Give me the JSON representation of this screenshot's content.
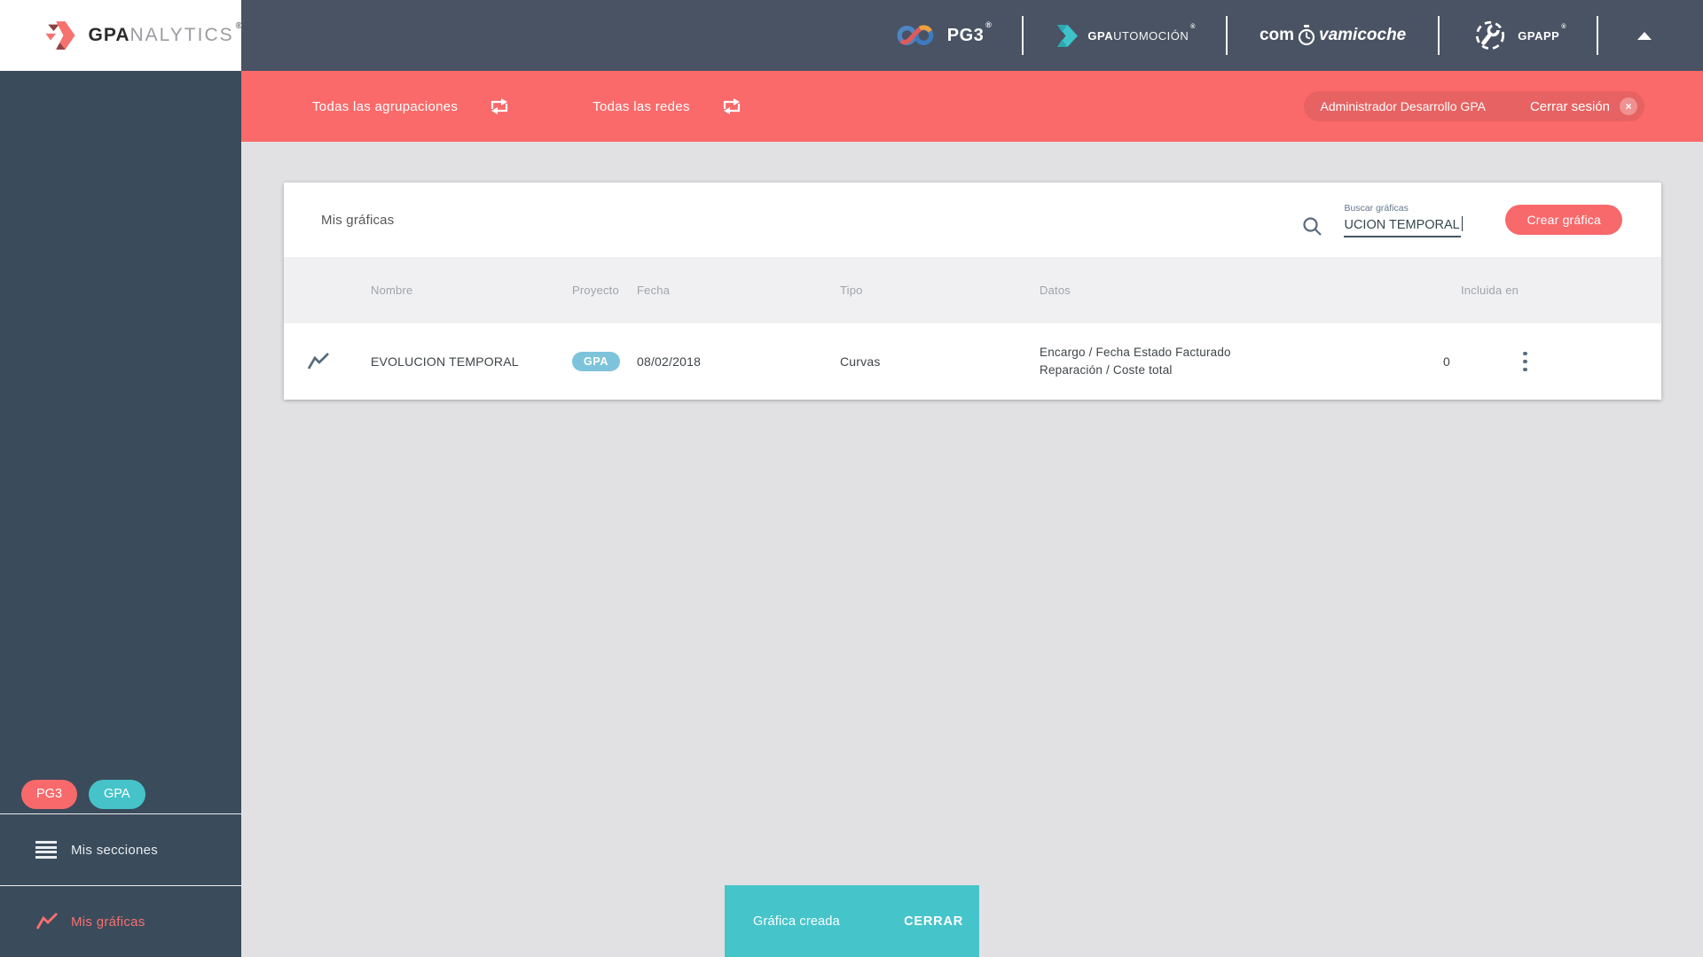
{
  "brand": {
    "logo_prefix": "GPA",
    "logo_suffix": "NALYTICS",
    "registered": "®"
  },
  "header": {
    "apps": {
      "pg3": {
        "name": "PG3",
        "reg": "®"
      },
      "auto": {
        "bold": "GPA",
        "rest": "UTOMOCIÓN",
        "reg": "®"
      },
      "coche": {
        "prefix": "com",
        "suffix": "vamicoche"
      },
      "gpapp": {
        "name": "GPAPP",
        "reg": "®"
      }
    }
  },
  "filter_bar": {
    "groupings_label": "Todas las agrupaciones",
    "networks_label": "Todas las redes",
    "user_name": "Administrador Desarrollo GPA",
    "logout_label": "Cerrar sesión",
    "close_glyph": "×"
  },
  "sidebar": {
    "badges": [
      {
        "label": "PG3"
      },
      {
        "label": "GPA"
      }
    ],
    "items": [
      {
        "label": "Mis secciones",
        "icon": "menu-icon",
        "active": false
      },
      {
        "label": "Mis gráficas",
        "icon": "line-chart-icon",
        "active": true
      }
    ]
  },
  "main": {
    "title": "Mis gráficas",
    "search": {
      "label": "Buscar gráficas",
      "value": "UCION TEMPORAL"
    },
    "create_button": "Crear gráfica",
    "table": {
      "columns": [
        "Nombre",
        "Proyecto",
        "Fecha",
        "Tipo",
        "Datos",
        "Incluida en"
      ],
      "rows": [
        {
          "name": "EVOLUCION TEMPORAL",
          "project": "GPA",
          "date": "08/02/2018",
          "type": "Curvas",
          "data_line1": "Encargo / Fecha Estado Facturado",
          "data_line2": "Reparación / Coste total",
          "included_in": "0"
        }
      ]
    }
  },
  "toast": {
    "message": "Gráfica creada",
    "action": "CERRAR"
  },
  "colors": {
    "accent_red": "#FA6A6A",
    "coral_button": "#F8696B",
    "accent_teal": "#45C3C9",
    "badge_blue": "#7DC3DC",
    "sidebar_dark": "#3A4B5B",
    "header_dark": "#4A5363",
    "content_bg": "#E1E1E4"
  }
}
